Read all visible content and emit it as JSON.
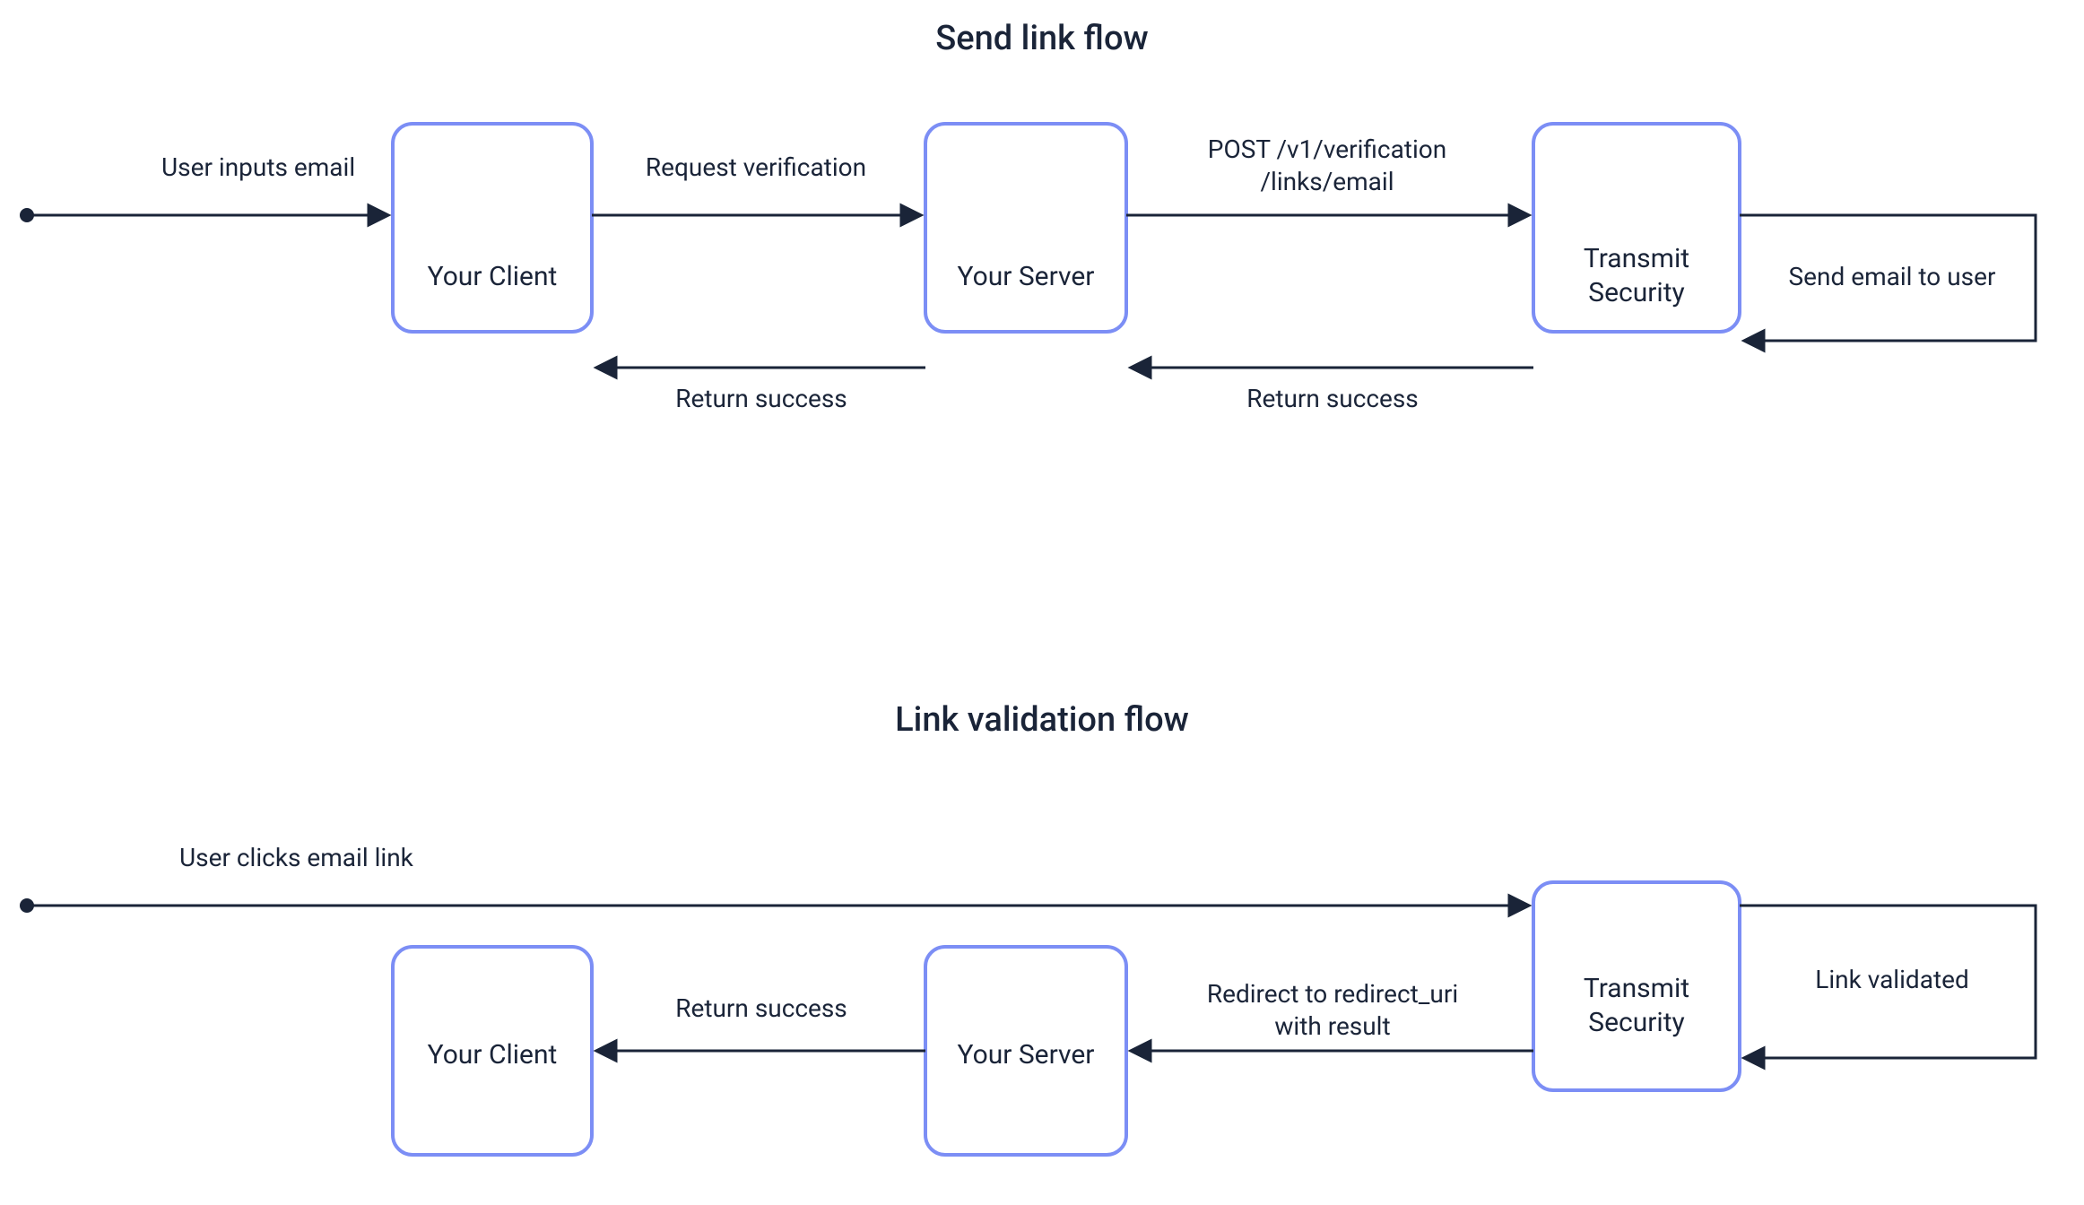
{
  "flow1": {
    "title": "Send link flow",
    "nodes": {
      "client": "Your Client",
      "server": "Your Server",
      "transmit_line1": "Transmit",
      "transmit_line2": "Security"
    },
    "edges": {
      "input": "User inputs email",
      "request": "Request verification",
      "post_line1": "POST /v1/verification",
      "post_line2": "/links/email",
      "selfloop": "Send email to user",
      "return_ts_sv": "Return success",
      "return_sv_cl": "Return success"
    }
  },
  "flow2": {
    "title": "Link validation flow",
    "nodes": {
      "client": "Your Client",
      "server": "Your Server",
      "transmit_line1": "Transmit",
      "transmit_line2": "Security"
    },
    "edges": {
      "click": "User clicks email link",
      "selfloop": "Link validated",
      "redirect_line1": "Redirect to redirect_uri",
      "redirect_line2": "with result",
      "return": "Return success"
    }
  }
}
